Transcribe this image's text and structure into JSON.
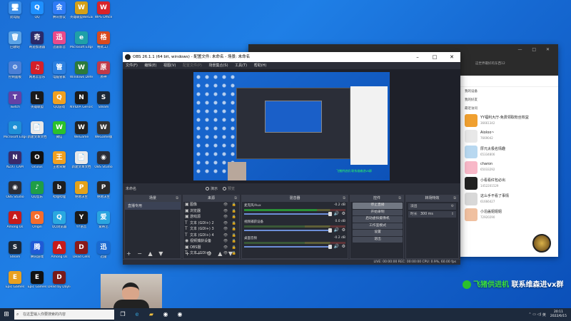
{
  "desktop": {
    "icons": [
      {
        "label": "此电脑",
        "c": "#3b8ee8",
        "g": "🖥"
      },
      {
        "label": "QQ",
        "c": "#1e90ff",
        "g": "Q"
      },
      {
        "label": "腾讯会议",
        "c": "#2f7cf6",
        "g": "会"
      },
      {
        "label": "英雄联盟WeGame",
        "c": "#d4a017",
        "g": "W"
      },
      {
        "label": "WPS Office",
        "c": "#d8232a",
        "g": "W"
      },
      {
        "label": "回收站",
        "c": "#5aa2e6",
        "g": "🗑"
      },
      {
        "label": "奇迹加速器",
        "c": "#2a2a6a",
        "g": "奇"
      },
      {
        "label": "迅雷影音",
        "c": "#e84a8a",
        "g": "迅"
      },
      {
        "label": "Microsoft Edge",
        "c": "#1fa0a8",
        "g": "e"
      },
      {
        "label": "格式工厂",
        "c": "#d84a1e",
        "g": "格"
      },
      {
        "label": "控制面板",
        "c": "#4a7fd6",
        "g": "⚙"
      },
      {
        "label": "网易云音乐",
        "c": "#d4202a",
        "g": "♫"
      },
      {
        "label": "电脑管家",
        "c": "#2b7fe0",
        "g": "管"
      },
      {
        "label": "Windows Defender",
        "c": "#2c7a3a",
        "g": "W"
      },
      {
        "label": "原神",
        "c": "#c03a4a",
        "g": "原"
      },
      {
        "label": "Twitch",
        "c": "#6441a5",
        "g": "T"
      },
      {
        "label": "英雄联盟",
        "c": "#1a1a1a",
        "g": "L"
      },
      {
        "label": "QQ游戏",
        "c": "#f0a020",
        "g": "Q"
      },
      {
        "label": "NVIDIA GeForce",
        "c": "#1a1a1a",
        "g": "N"
      },
      {
        "label": "Steam",
        "c": "#1b2838",
        "g": "S"
      },
      {
        "label": "Microsoft Edge",
        "c": "#1f8fd6",
        "g": "e"
      },
      {
        "label": "新建文本文档",
        "c": "#e8e8e8",
        "g": "📄"
      },
      {
        "label": "微信",
        "c": "#2bc12b",
        "g": "W"
      },
      {
        "label": "WeGame",
        "c": "#222",
        "g": "W"
      },
      {
        "label": "WeGame版",
        "c": "#333",
        "g": "W"
      },
      {
        "label": "NZXT CAM",
        "c": "#3a2a6a",
        "g": "N"
      },
      {
        "label": "Oculus",
        "c": "#111",
        "g": "O"
      },
      {
        "label": "王者荣耀",
        "c": "#f0a020",
        "g": "王"
      },
      {
        "label": "新建文本文档",
        "c": "#e8e8e8",
        "g": "📄"
      },
      {
        "label": "OBS Studio",
        "c": "#2b2e38",
        "g": "◉"
      },
      {
        "label": "OBS Studio",
        "c": "#2b2e38",
        "g": "◉"
      },
      {
        "label": "QQ音乐",
        "c": "#1f9e47",
        "g": "♪"
      },
      {
        "label": "哔哩哔哩",
        "c": "#1e1e1e",
        "g": "b"
      },
      {
        "label": "绝地求生",
        "c": "#e3a21a",
        "g": "P"
      },
      {
        "label": "绝地求生",
        "c": "#2a2a2a",
        "g": "P"
      },
      {
        "label": "Among Us",
        "c": "#c61b1b",
        "g": "A"
      },
      {
        "label": "Origin",
        "c": "#f56c2d",
        "g": "O"
      },
      {
        "label": "QQ浏览器",
        "c": "#2aa8e0",
        "g": "Q"
      },
      {
        "label": "YY语音",
        "c": "#1a1a1a",
        "g": "Y"
      },
      {
        "label": "爱奇艺",
        "c": "#2aa5e0",
        "g": "爱"
      },
      {
        "label": "Steam",
        "c": "#1b2838",
        "g": "S"
      },
      {
        "label": "腾讯游戏",
        "c": "#1f5ad6",
        "g": "腾"
      },
      {
        "label": "Among Us",
        "c": "#c61b1b",
        "g": "A"
      },
      {
        "label": "Dead Cells",
        "c": "#8a1a1a",
        "g": "D"
      },
      {
        "label": "迅雷",
        "c": "#1a6ad2",
        "g": "迅"
      },
      {
        "label": "Epic Games",
        "c": "#e8a020",
        "g": "E"
      },
      {
        "label": "Epic Games",
        "c": "#111",
        "g": "E"
      },
      {
        "label": "Dead by Daylight",
        "c": "#7a1a1a",
        "g": "D"
      }
    ],
    "watermark_prefix": "",
    "watermark_green": "飞猪供进机",
    "watermark_text": "联系维森进vx群"
  },
  "chat": {
    "title": "玉门",
    "subtitle": "这世界最好的东西12",
    "groups": [
      "我的设备",
      "我的好友",
      "最近访问"
    ],
    "contacts": [
      {
        "name": "YY福利大厅-免费领取粉丝权益",
        "date": "36661342",
        "c": "#f0a030"
      },
      {
        "name": "Aioloo~",
        "date": "7669042",
        "c": "#e8e8e8"
      },
      {
        "name": "厚元太极名情趣",
        "date": "65334806",
        "c": "#b8d8f0"
      },
      {
        "name": "charon",
        "date": "65033292",
        "c": "#f8b8c8"
      },
      {
        "name": "小看看红包必出",
        "date": "1452201529",
        "c": "#222"
      },
      {
        "name": "这么手不看了事情",
        "date": "61666427",
        "c": "#d8d8d8"
      },
      {
        "name": "小泊盖姐姐姐",
        "date": "72920290",
        "c": "#f0c0a0"
      }
    ]
  },
  "obs": {
    "title": "OBS 26.1.1 (64 bit, windows) - 配置文件: 未命名 - 场景: 未命名",
    "menu": [
      "文件(F)",
      "编辑(E)",
      "视图(V)",
      "配置文件(P)",
      "场景集合(S)",
      "工具(T)",
      "帮助(H)"
    ],
    "preview_caption": "飞猪供进机 联系维森进vx群",
    "scene_label": "未命名",
    "mode_studio": "演示",
    "mode_preview": "预览",
    "docks": {
      "scenes": "场景",
      "sources": "来源",
      "mixer": "混音器",
      "controls": "控件",
      "transitions": "转场特效"
    },
    "scenes": [
      "直播专用"
    ],
    "sources": [
      {
        "icon": "▣",
        "name": "图像"
      },
      {
        "icon": "▣",
        "name": "浏览器"
      },
      {
        "icon": "▣",
        "name": "游戏源"
      },
      {
        "icon": "T",
        "name": "文本 (GDI+) 2"
      },
      {
        "icon": "T",
        "name": "文本 (GDI+) 3"
      },
      {
        "icon": "T",
        "name": "文本 (GDI+) 4"
      },
      {
        "icon": "◉",
        "name": "视频捕获设备"
      },
      {
        "icon": "▣",
        "name": "OBS摄"
      },
      {
        "icon": "T",
        "name": "文本 (GDI+)"
      }
    ],
    "mixer": [
      {
        "name": "麦克风/Aux",
        "db": "-0.2 dB",
        "level": 0.72
      },
      {
        "name": "视频捕获设备",
        "db": "0.0 dB",
        "level": 0.0
      },
      {
        "name": "桌面音频",
        "db": "-0.2 dB",
        "level": 0.0
      }
    ],
    "controls": [
      "停止直播",
      "开始录制",
      "启动虚拟摄像机",
      "工作室模式",
      "设置",
      "退出"
    ],
    "transition_value": "淡出",
    "duration_label": "时长",
    "duration_value": "300 ms",
    "status": "LIVE: 00:00:00   REC: 00:00:00   CPU: 0.9%, 60.00 fps"
  },
  "taskbar": {
    "search_placeholder": "在这里输入你要搜索的内容",
    "time": "20:11",
    "date": "2022/6/15",
    "lang": "英"
  }
}
